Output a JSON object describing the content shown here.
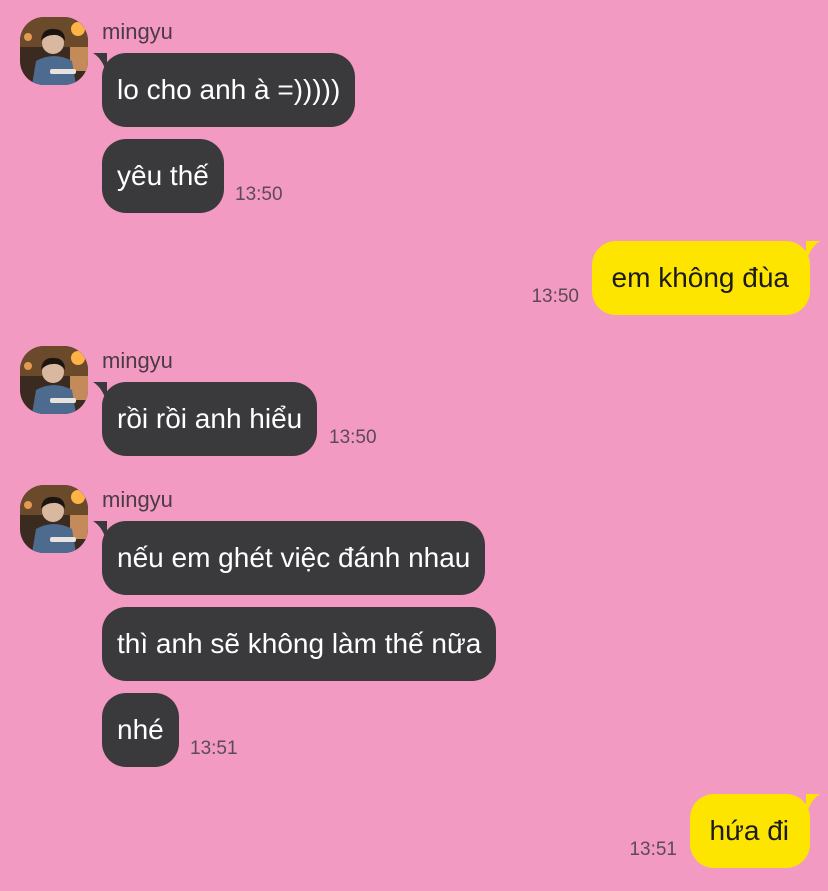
{
  "theme": {
    "background": "#f39ac3",
    "incoming_bubble": "#3a3a3c",
    "incoming_text": "#ffffff",
    "outgoing_bubble": "#fee500",
    "outgoing_text": "#1b1b1b",
    "timestamp": "#5c4a55"
  },
  "chat": {
    "groups": [
      {
        "direction": "incoming",
        "sender": "mingyu",
        "avatar_icon": "profile-photo",
        "messages": [
          {
            "text": "lo cho anh à =)))))"
          },
          {
            "text": "yêu thế",
            "time": "13:50"
          }
        ]
      },
      {
        "direction": "outgoing",
        "messages": [
          {
            "text": "em không đùa",
            "time": "13:50"
          }
        ]
      },
      {
        "direction": "incoming",
        "sender": "mingyu",
        "avatar_icon": "profile-photo",
        "messages": [
          {
            "text": "rồi rồi anh hiểu",
            "time": "13:50"
          }
        ]
      },
      {
        "direction": "incoming",
        "sender": "mingyu",
        "avatar_icon": "profile-photo",
        "messages": [
          {
            "text": "nếu em ghét việc đánh nhau"
          },
          {
            "text": "thì anh sẽ không làm thế nữa"
          },
          {
            "text": "nhé",
            "time": "13:51"
          }
        ]
      },
      {
        "direction": "outgoing",
        "messages": [
          {
            "text": "hứa đi",
            "time": "13:51"
          }
        ]
      }
    ]
  }
}
